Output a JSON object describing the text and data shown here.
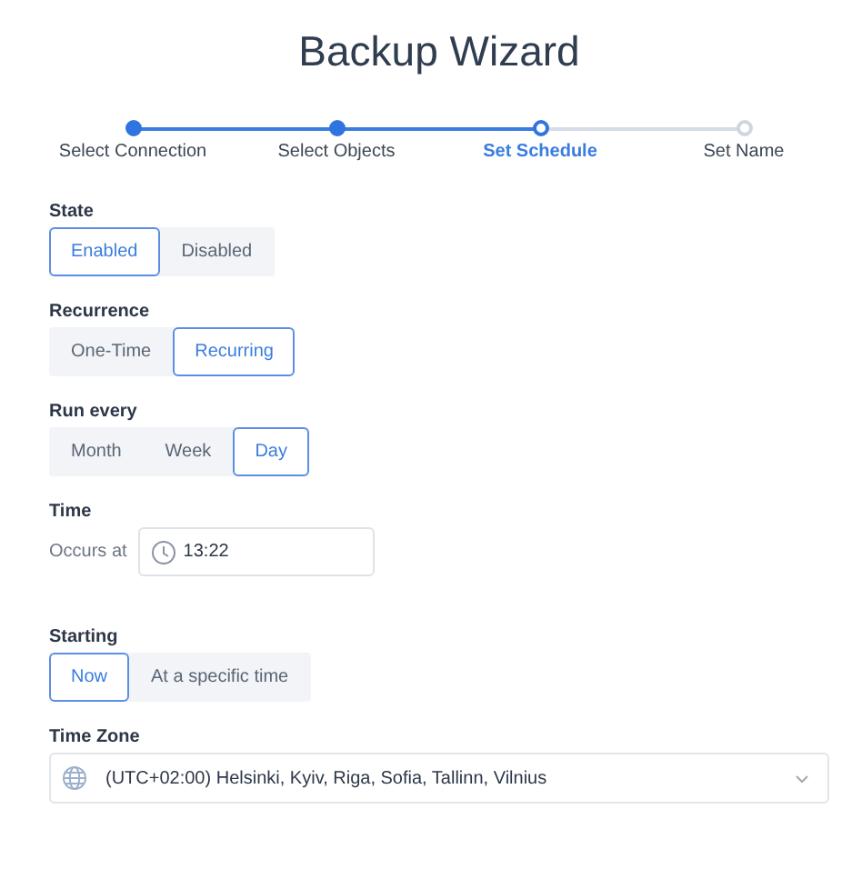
{
  "title": "Backup Wizard",
  "steps": [
    {
      "label": "Select Connection",
      "completed": true,
      "selected": false
    },
    {
      "label": "Select Objects",
      "completed": true,
      "selected": false
    },
    {
      "label": "Set Schedule",
      "completed": false,
      "selected": true
    },
    {
      "label": "Set Name",
      "completed": false,
      "selected": false
    }
  ],
  "sections": [
    {
      "kind": "segmented",
      "label": "State",
      "options": [
        {
          "label": "Enabled",
          "selected": true
        },
        {
          "label": "Disabled",
          "selected": false
        }
      ]
    },
    {
      "kind": "segmented",
      "label": "Recurrence",
      "options": [
        {
          "label": "One-Time",
          "selected": false
        },
        {
          "label": "Recurring",
          "selected": true
        }
      ]
    },
    {
      "kind": "segmented",
      "label": "Run every",
      "options": [
        {
          "label": "Month",
          "selected": false
        },
        {
          "label": "Week",
          "selected": false
        },
        {
          "label": "Day",
          "selected": true
        }
      ]
    },
    {
      "kind": "time",
      "label": "Time",
      "prefix": "Occurs at",
      "value": "13:22"
    },
    {
      "kind": "segmented",
      "label": "Starting",
      "options": [
        {
          "label": "Now",
          "selected": true
        },
        {
          "label": "At a specific time",
          "selected": false
        }
      ]
    },
    {
      "kind": "select",
      "label": "Time Zone",
      "value": "(UTC+02:00) Helsinki, Kyiv, Riga, Sofia, Tallinn, Vilnius"
    }
  ]
}
